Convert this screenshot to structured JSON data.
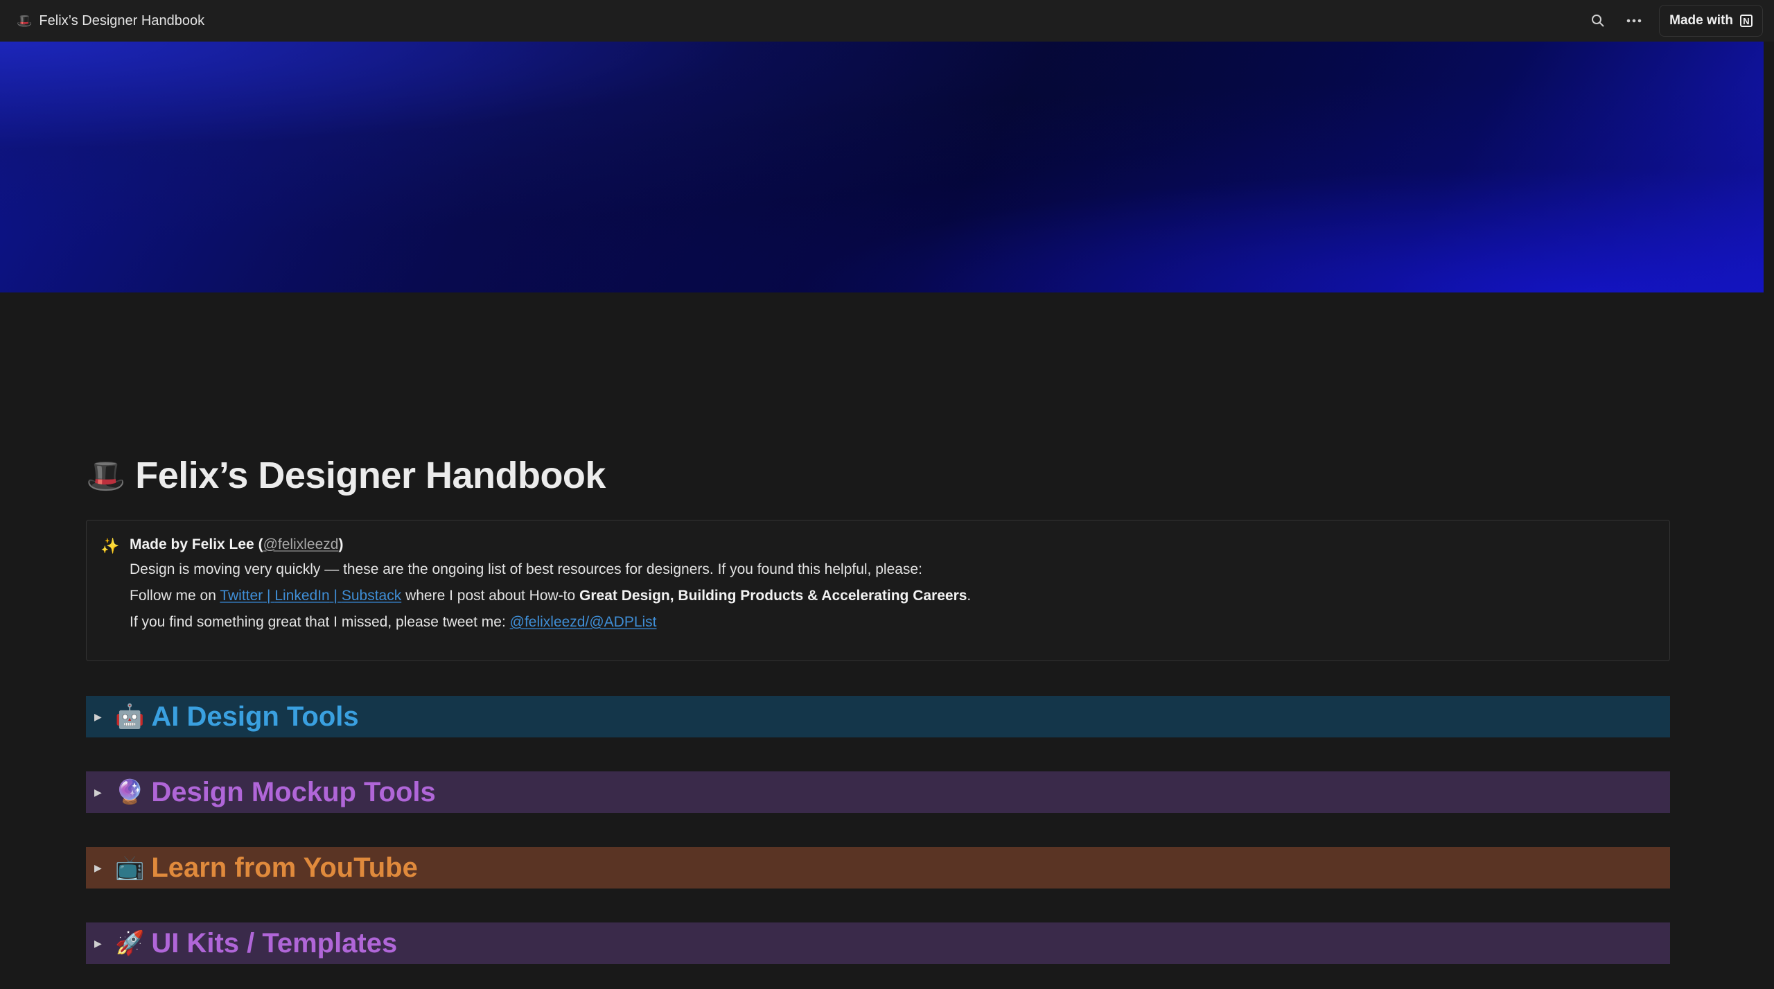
{
  "topbar": {
    "page_icon": "🎩",
    "page_title": "Felix’s Designer Handbook",
    "search_icon": "search-icon",
    "more_icon": "more-icon",
    "made_with_label": "Made with",
    "notion_logo_letter": "N"
  },
  "page": {
    "icon": "🎩",
    "title": "Felix’s Designer Handbook"
  },
  "callout": {
    "icon": "✨",
    "heading_prefix": "Made by Felix Lee (",
    "heading_handle": "@felixleezd",
    "heading_suffix": ")",
    "line1": "Design is moving very quickly — these are the ongoing list of best resources for designers. If you found this helpful, please:",
    "line2_prefix": "Follow me on ",
    "link_twitter": "Twitter",
    "sep1": " | ",
    "link_linkedin": "LinkedIn",
    "sep2": " | ",
    "link_substack": "Substack",
    "line2_middle": " where I post about How-to ",
    "line2_bold": "Great Design, Building Products & Accelerating Careers",
    "line2_end": ".",
    "line3_prefix": "If you find something great that I missed, please tweet me: ",
    "link_handle1": "@felixleezd",
    "slash": "/",
    "link_handle2": "@ADPList"
  },
  "toggles": [
    {
      "emoji": "🤖",
      "label": "AI Design Tools",
      "color": "#3aa0e0",
      "bg": "#14364a"
    },
    {
      "emoji": "🔮",
      "label": "Design Mockup Tools",
      "color": "#b066d8",
      "bg": "#3a2a4a"
    },
    {
      "emoji": "📺",
      "label": "Learn from YouTube",
      "color": "#e08a3c",
      "bg": "#5a3424"
    },
    {
      "emoji": "🚀",
      "label": "UI Kits / Templates",
      "color": "#b066d8",
      "bg": "#3a2a4a"
    }
  ]
}
